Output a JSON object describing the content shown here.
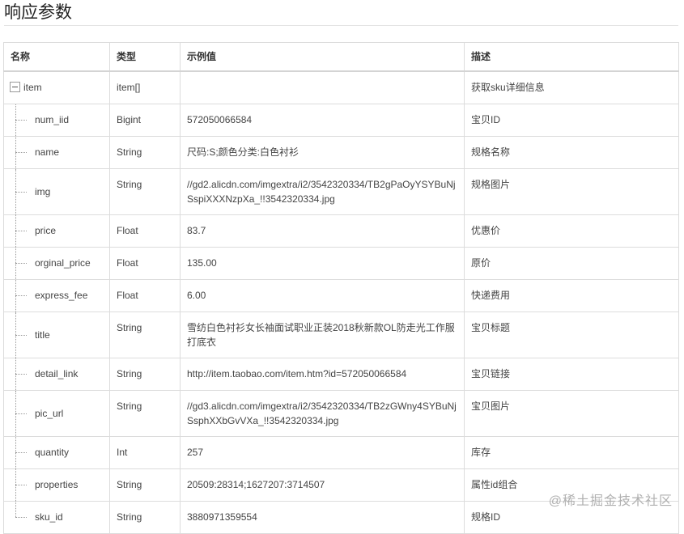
{
  "section_title": "响应参数",
  "headers": {
    "name": "名称",
    "type": "类型",
    "example": "示例值",
    "desc": "描述"
  },
  "root": {
    "name": "item",
    "type": "item[]",
    "example": "",
    "desc": "获取sku详细信息"
  },
  "rows": [
    {
      "name": "num_iid",
      "type": "Bigint",
      "example": "572050066584",
      "desc": "宝贝ID"
    },
    {
      "name": "name",
      "type": "String",
      "example": "尺码:S;颜色分类:白色衬衫",
      "desc": "规格名称"
    },
    {
      "name": "img",
      "type": "String",
      "example": "//gd2.alicdn.com/imgextra/i2/3542320334/TB2gPaOyYSYBuNjSspiXXXNzpXa_!!3542320334.jpg",
      "desc": "规格图片"
    },
    {
      "name": "price",
      "type": "Float",
      "example": "83.7",
      "desc": "优惠价"
    },
    {
      "name": "orginal_price",
      "type": "Float",
      "example": "135.00",
      "desc": "原价"
    },
    {
      "name": "express_fee",
      "type": "Float",
      "example": "6.00",
      "desc": "快递费用"
    },
    {
      "name": "title",
      "type": "String",
      "example": "雪纺白色衬衫女长袖面试职业正装2018秋新款OL防走光工作服打底衣",
      "desc": "宝贝标题"
    },
    {
      "name": "detail_link",
      "type": "String",
      "example": "http://item.taobao.com/item.htm?id=572050066584",
      "desc": "宝贝链接"
    },
    {
      "name": "pic_url",
      "type": "String",
      "example": "//gd3.alicdn.com/imgextra/i2/3542320334/TB2zGWny4SYBuNjSsphXXbGvVXa_!!3542320334.jpg",
      "desc": "宝贝图片"
    },
    {
      "name": "quantity",
      "type": "Int",
      "example": "257",
      "desc": "库存"
    },
    {
      "name": "properties",
      "type": "String",
      "example": "20509:28314;1627207:3714507",
      "desc": "属性id组合"
    },
    {
      "name": "sku_id",
      "type": "String",
      "example": "3880971359554",
      "desc": "规格ID"
    }
  ],
  "watermark": "@稀土掘金技术社区"
}
